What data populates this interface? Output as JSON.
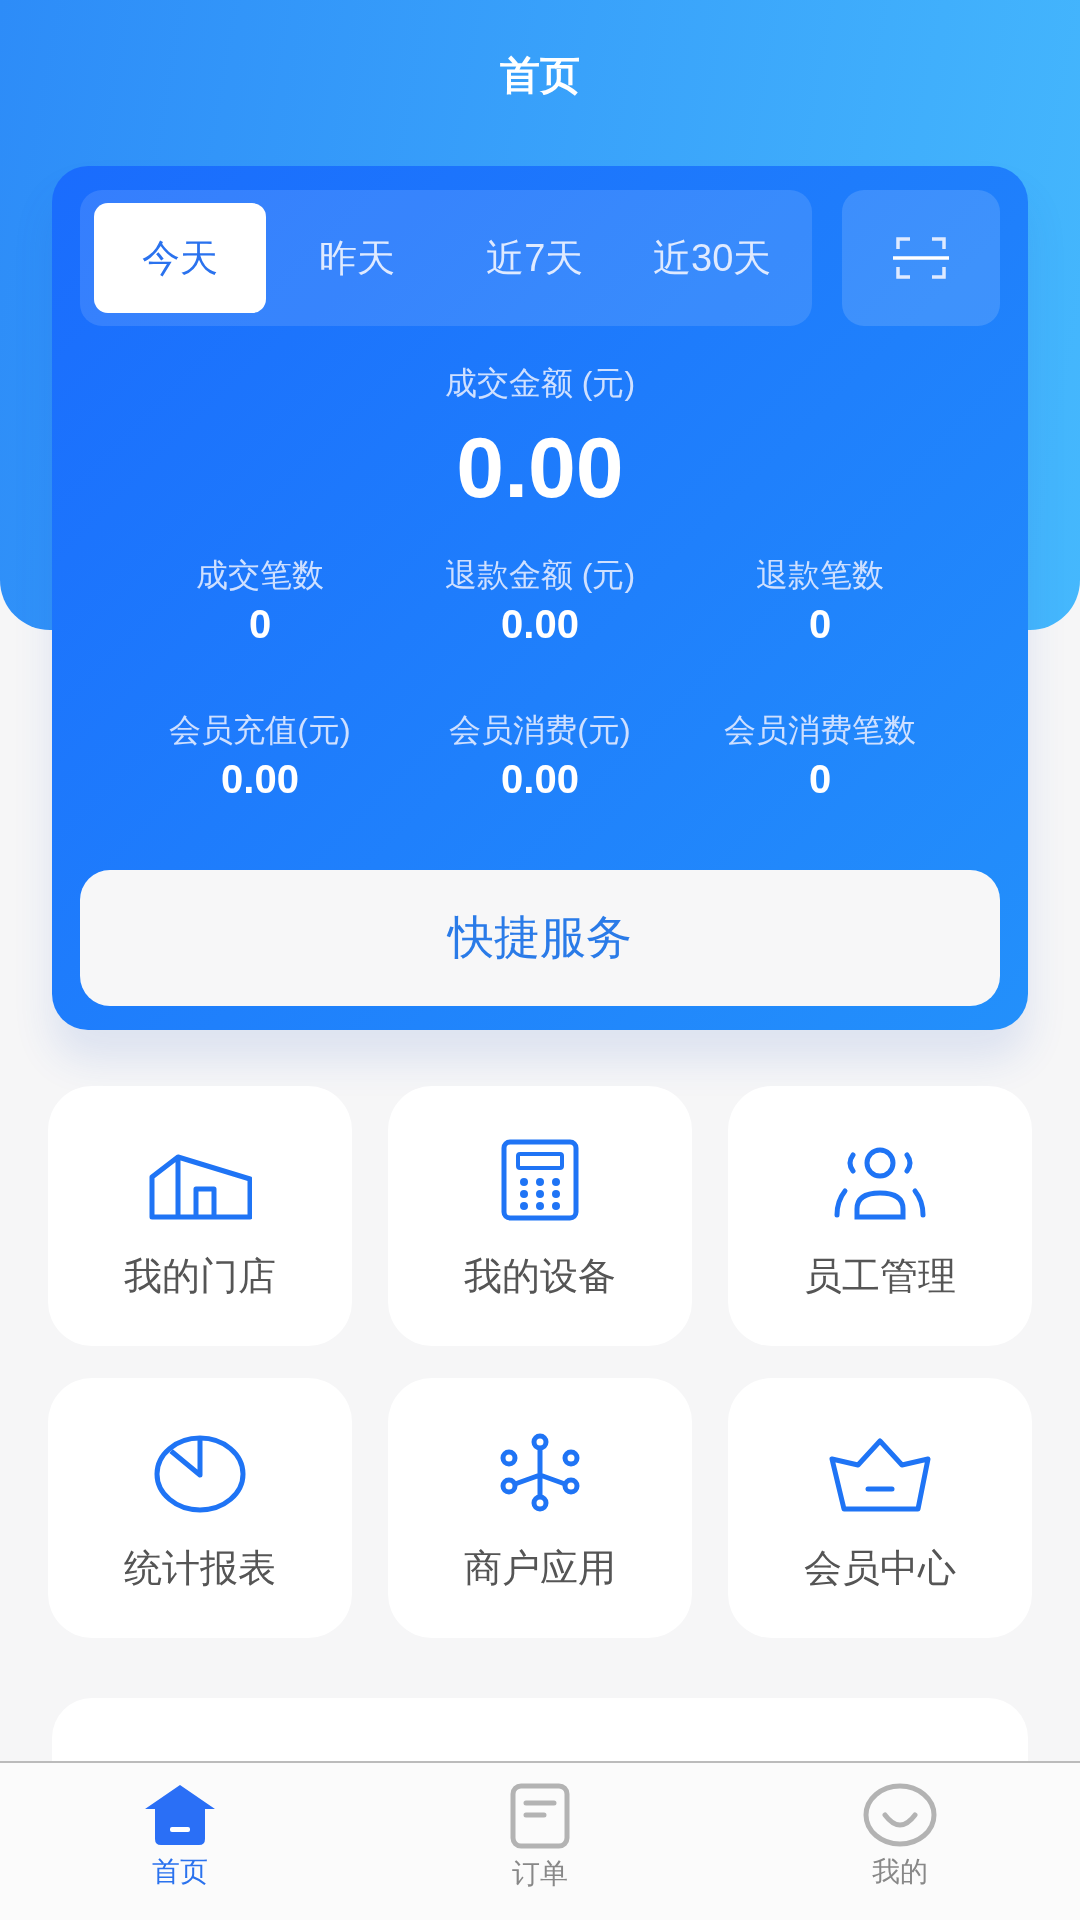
{
  "header": {
    "title": "首页"
  },
  "range_tabs": [
    {
      "label": "今天",
      "selected": true
    },
    {
      "label": "昨天",
      "selected": false
    },
    {
      "label": "近7天",
      "selected": false
    },
    {
      "label": "近30天",
      "selected": false
    }
  ],
  "summary": {
    "label": "成交金额 (元)",
    "value": "0.00"
  },
  "stats": [
    {
      "label": "成交笔数",
      "value": "0"
    },
    {
      "label": "退款金额 (元)",
      "value": "0.00"
    },
    {
      "label": "退款笔数",
      "value": "0"
    },
    {
      "label": "会员充值(元)",
      "value": "0.00"
    },
    {
      "label": "会员消费(元)",
      "value": "0.00"
    },
    {
      "label": "会员消费笔数",
      "value": "0"
    }
  ],
  "quick_service": "快捷服务",
  "shortcuts": [
    {
      "label": "我的门店"
    },
    {
      "label": "我的设备"
    },
    {
      "label": "员工管理"
    },
    {
      "label": "统计报表"
    },
    {
      "label": "商户应用"
    },
    {
      "label": "会员中心"
    }
  ],
  "bottom_nav": [
    {
      "label": "首页",
      "selected": true
    },
    {
      "label": "订单",
      "selected": false
    },
    {
      "label": "我的",
      "selected": false
    }
  ]
}
